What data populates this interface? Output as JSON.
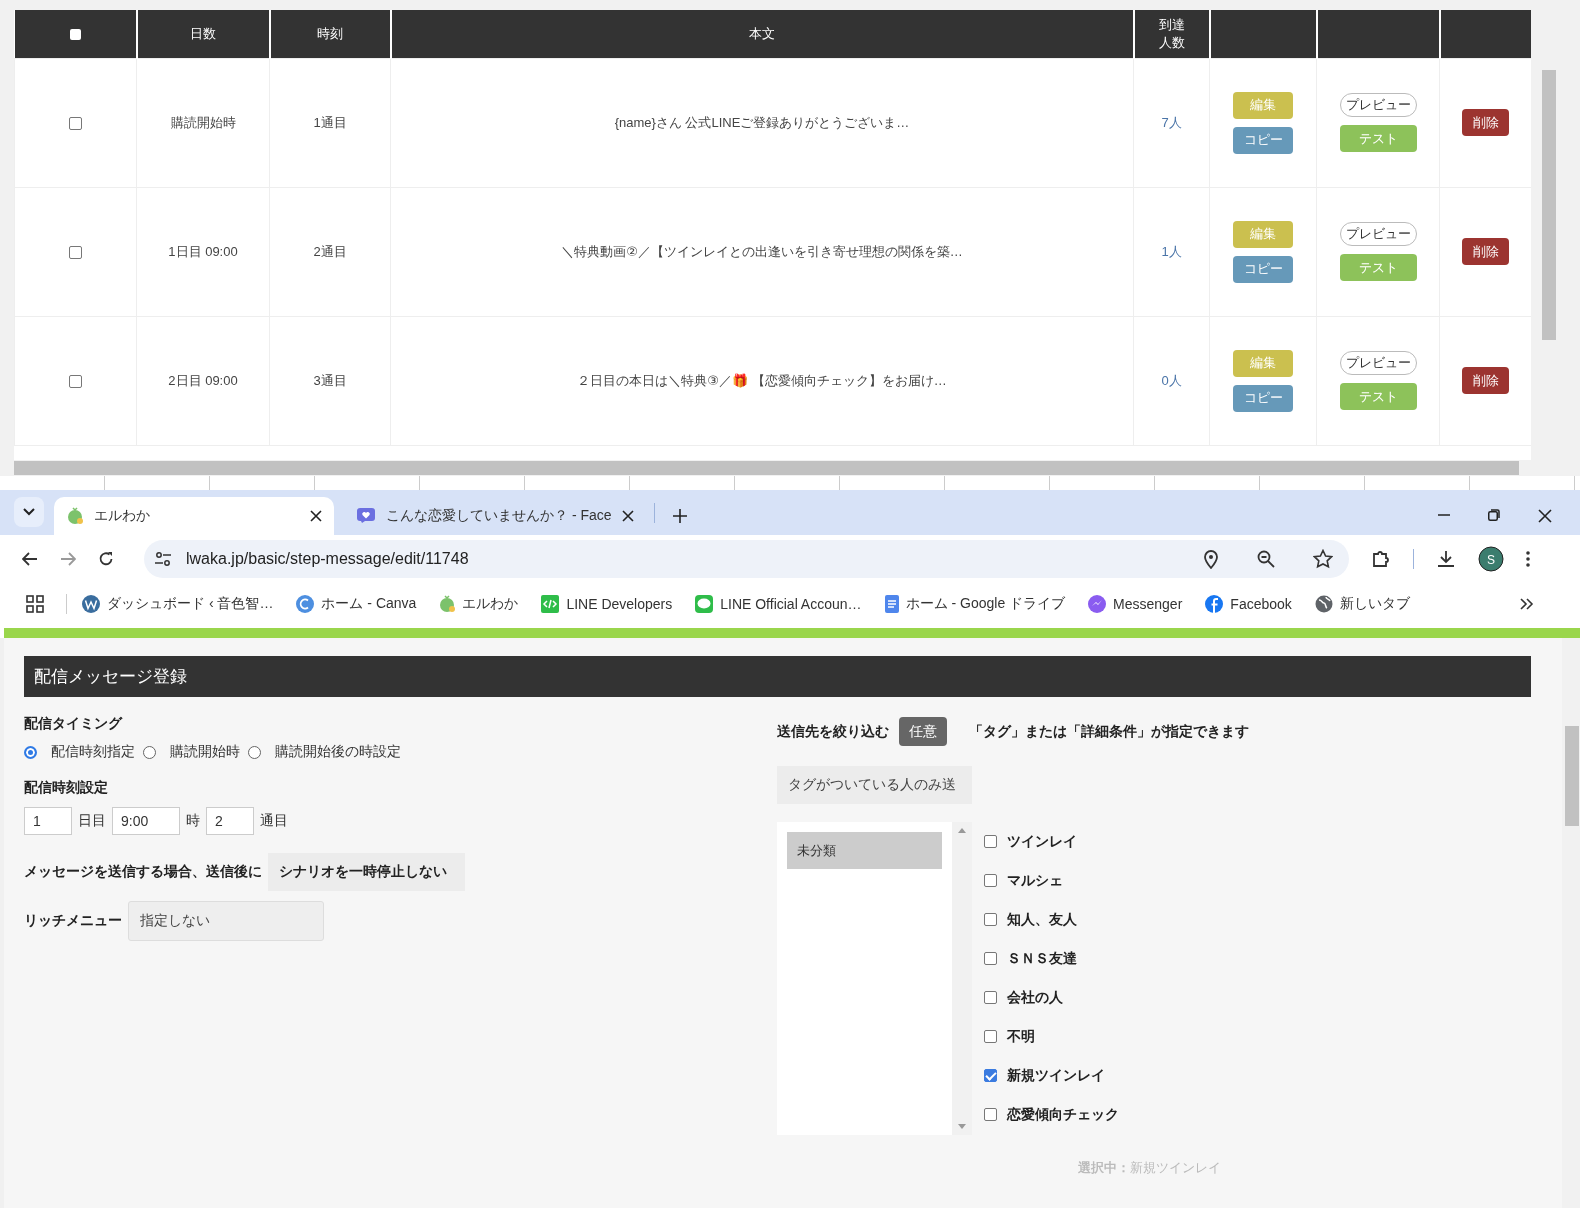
{
  "message_table": {
    "header_checkbox": {
      "checked": false
    },
    "columns": [
      "日数",
      "時刻",
      "本文",
      "到達人数"
    ],
    "rows": [
      {
        "checked": false,
        "day": "購読開始時",
        "order": "1通目",
        "body": "{name}さん 公式LINEご登録ありがとうございま…",
        "reach": "7人",
        "actions": [
          {
            "kind": "edit",
            "label": "編集"
          },
          {
            "kind": "copy",
            "label": "コピー"
          },
          {
            "kind": "preview",
            "label": "プレビュー"
          },
          {
            "kind": "test",
            "label": "テスト"
          },
          {
            "kind": "delete",
            "label": "削除"
          }
        ]
      },
      {
        "checked": false,
        "day": "1日目 09:00",
        "order": "2通目",
        "body": "＼特典動画②／【ツインレイとの出逢いを引き寄せ理想の関係を築…",
        "reach": "1人",
        "actions": [
          {
            "kind": "edit",
            "label": "編集"
          },
          {
            "kind": "copy",
            "label": "コピー"
          },
          {
            "kind": "preview",
            "label": "プレビュー"
          },
          {
            "kind": "test",
            "label": "テスト"
          },
          {
            "kind": "delete",
            "label": "削除"
          }
        ]
      },
      {
        "checked": false,
        "day": "2日目 09:00",
        "order": "3通目",
        "body": "２日目の本日は＼特典③／🎁 【恋愛傾向チェック】をお届け…",
        "reach": "0人",
        "actions": [
          {
            "kind": "edit",
            "label": "編集"
          },
          {
            "kind": "copy",
            "label": "コピー"
          },
          {
            "kind": "preview",
            "label": "プレビュー"
          },
          {
            "kind": "test",
            "label": "テスト"
          },
          {
            "kind": "delete",
            "label": "削除"
          }
        ]
      }
    ]
  },
  "browser": {
    "tabs": [
      {
        "title": "エルわか",
        "selected": true,
        "kind": "sprout"
      },
      {
        "title": "こんな恋愛していませんか？ - Face",
        "selected": false,
        "kind": "heart"
      }
    ],
    "url": "lwaka.jp/basic/step-message/edit/11748",
    "profile": "S",
    "bookmarks": [
      {
        "kind": "wordpress",
        "label": "ダッシュボード ‹ 音色智…"
      },
      {
        "kind": "canva",
        "label": "ホーム - Canva"
      },
      {
        "kind": "sprout",
        "label": "エルわか"
      },
      {
        "kind": "code",
        "label": "LINE Developers"
      },
      {
        "kind": "chat",
        "label": "LINE Official Accoun…"
      },
      {
        "kind": "docs",
        "label": "ホーム - Google ドライブ"
      },
      {
        "kind": "messenger",
        "label": "Messenger"
      },
      {
        "kind": "facebook",
        "label": "Facebook"
      },
      {
        "kind": "globe",
        "label": "新しいタブ"
      }
    ]
  },
  "form": {
    "title": "配信メッセージ登録",
    "timing": {
      "label": "配信タイミング",
      "options": [
        {
          "label": "配信時刻指定",
          "selected": true
        },
        {
          "label": "購読開始時",
          "selected": false
        },
        {
          "label": "購読開始後の時設定",
          "selected": false
        }
      ]
    },
    "time_setting": {
      "label": "配信時刻設定",
      "day": "1",
      "day_unit": "日目",
      "time": "9:00",
      "time_unit": "時",
      "count": "2",
      "count_unit": "通目"
    },
    "pause": {
      "label": "メッセージを送信する場合、送信後に",
      "value": "シナリオを一時停止しない"
    },
    "rich_menu": {
      "label": "リッチメニュー",
      "value": "指定しない"
    },
    "filter": {
      "label": "送信先を絞り込む",
      "badge": "任意",
      "hint": "「タグ」または「詳細条件」が指定できます",
      "mode": "タグがついている人のみ送",
      "categories": [
        {
          "label": "未分類",
          "selected": true
        }
      ],
      "tags": [
        {
          "label": "ツインレイ",
          "checked": false
        },
        {
          "label": "マルシェ",
          "checked": false
        },
        {
          "label": "知人、友人",
          "checked": false
        },
        {
          "label": "ＳＮＳ友達",
          "checked": false
        },
        {
          "label": "会社の人",
          "checked": false
        },
        {
          "label": "不明",
          "checked": false
        },
        {
          "label": "新規ツインレイ",
          "checked": true
        },
        {
          "label": "恋愛傾向チェック",
          "checked": false
        }
      ],
      "summary": "**選択中：**新規ツインレイ"
    }
  }
}
